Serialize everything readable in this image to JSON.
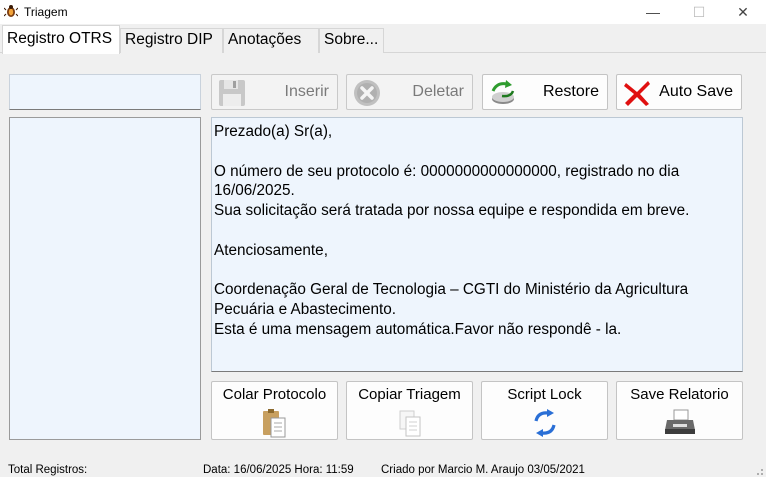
{
  "window": {
    "title": "Triagem",
    "icon": "bug-app-icon",
    "controls": {
      "minimize": "—",
      "maximize": "☐",
      "close": "✕"
    }
  },
  "tabs": [
    {
      "label": "Registro OTRS",
      "active": true
    },
    {
      "label": "Registro DIP",
      "active": false
    },
    {
      "label": "Anotações",
      "active": false
    },
    {
      "label": "Sobre...",
      "active": false
    }
  ],
  "left_panel": {
    "input_value": "",
    "list_items": []
  },
  "toolbar": {
    "inserir": {
      "label": "Inserir",
      "icon": "floppy-disk-icon",
      "enabled": false
    },
    "deletar": {
      "label": "Deletar",
      "icon": "delete-x-circle-icon",
      "enabled": false
    },
    "restore": {
      "label": "Restore",
      "icon": "restore-recycle-icon",
      "enabled": true
    },
    "autosave": {
      "label": "Auto Save",
      "icon": "red-x-icon",
      "enabled": true
    }
  },
  "message": {
    "text": "Prezado(a) Sr(a),\n\nO número de seu protocolo é: 0000000000000000, registrado no dia\n16/06/2025.\nSua solicitação será tratada por nossa equipe e respondida em breve.\n\nAtenciosamente,\n\nCoordenação Geral de Tecnologia – CGTI do Ministério da Agricultura\nPecuária e Abastecimento.\nEsta é uma mensagem automática.Favor não respondê - la."
  },
  "actions": {
    "colar": {
      "label": "Colar Protocolo",
      "icon": "paste-clipboard-icon"
    },
    "copiar": {
      "label": "Copiar Triagem",
      "icon": "copy-document-icon"
    },
    "script": {
      "label": "Script Lock",
      "icon": "refresh-arrows-icon"
    },
    "relatorio": {
      "label": "Save Relatorio",
      "icon": "printer-icon"
    }
  },
  "status": {
    "total": "Total Registros:",
    "datetime": "Data: 16/06/2025 Hora: 11:59",
    "credits": "Criado por Marcio M. Araujo 03/05/2021"
  }
}
